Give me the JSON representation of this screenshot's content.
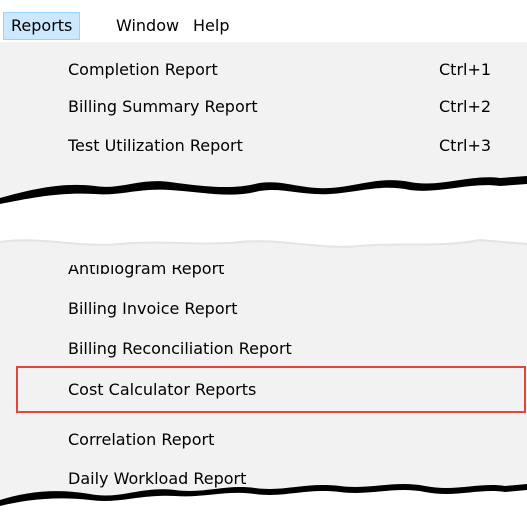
{
  "menubar": {
    "items": [
      {
        "label": "Reports"
      },
      {
        "label": "Window"
      },
      {
        "label": "Help"
      }
    ]
  },
  "menu": {
    "items": [
      {
        "label": "Completion Report",
        "shortcut": "Ctrl+1"
      },
      {
        "label": "Billing Summary Report",
        "shortcut": "Ctrl+2"
      },
      {
        "label": "Test Utilization Report",
        "shortcut": "Ctrl+3"
      },
      {
        "label": "Antibiogram Report"
      },
      {
        "label": "Billing Invoice Report"
      },
      {
        "label": "Billing Reconciliation Report"
      },
      {
        "label": "Cost Calculator Reports"
      },
      {
        "label": "Correlation Report"
      },
      {
        "label": "Daily Workload Report"
      }
    ]
  },
  "colors": {
    "active_menu_bg": "#cce8ff",
    "menu_bg": "#f2f2f2",
    "highlight_border": "#e2463a"
  }
}
